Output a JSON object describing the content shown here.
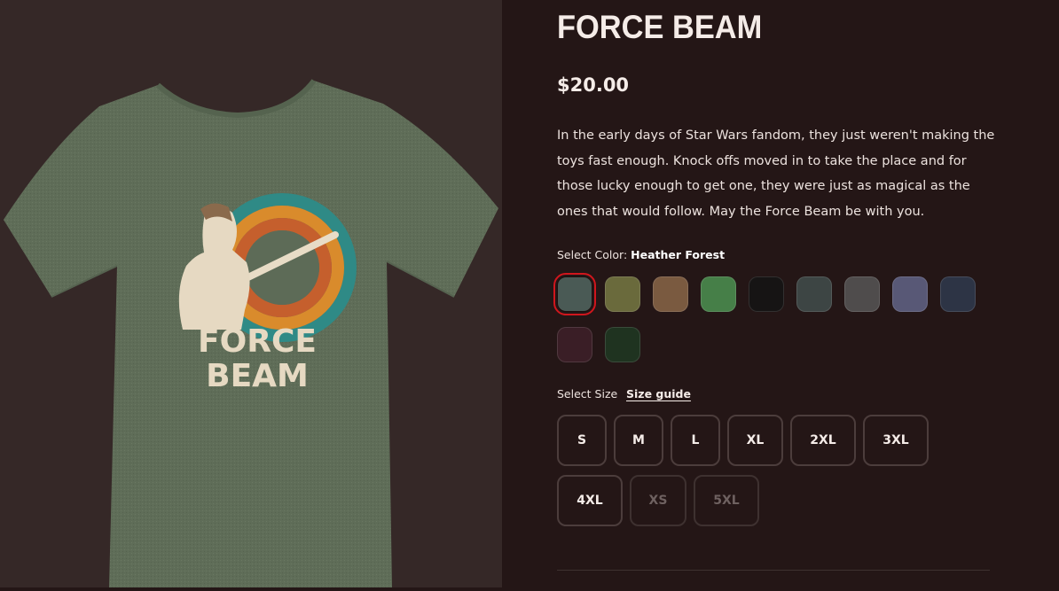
{
  "product": {
    "title": "FORCE BEAM",
    "price": "$20.00",
    "description": "In the early days of Star Wars fandom, they just weren't making the toys fast enough.  Knock offs moved in to take the place and for those lucky enough to get one, they were just as magical as the ones that would follow.  May the Force Beam be with you."
  },
  "shirt": {
    "image_icon": "t-shirt-image",
    "color": "#5d6b57",
    "print_text_line1": "FORCE",
    "print_text_line2": "BEAM"
  },
  "color_select": {
    "label": "Select Color:",
    "selected_name": "Heather Forest",
    "swatches": [
      "#4a5a55",
      "#6a6a3c",
      "#7a5a40",
      "#467f48",
      "#161414",
      "#3d4544",
      "#4f4c4c",
      "#585876",
      "#2d3445",
      "#3a1e26",
      "#1f3320"
    ],
    "selected_index": 0
  },
  "size_select": {
    "label": "Select Size",
    "guide_label": "Size guide",
    "sizes": [
      {
        "label": "S",
        "available": true
      },
      {
        "label": "M",
        "available": true
      },
      {
        "label": "L",
        "available": true
      },
      {
        "label": "XL",
        "available": true
      },
      {
        "label": "2XL",
        "available": true
      },
      {
        "label": "3XL",
        "available": true
      },
      {
        "label": "4XL",
        "available": true
      },
      {
        "label": "XS",
        "available": false
      },
      {
        "label": "5XL",
        "available": false
      }
    ]
  }
}
